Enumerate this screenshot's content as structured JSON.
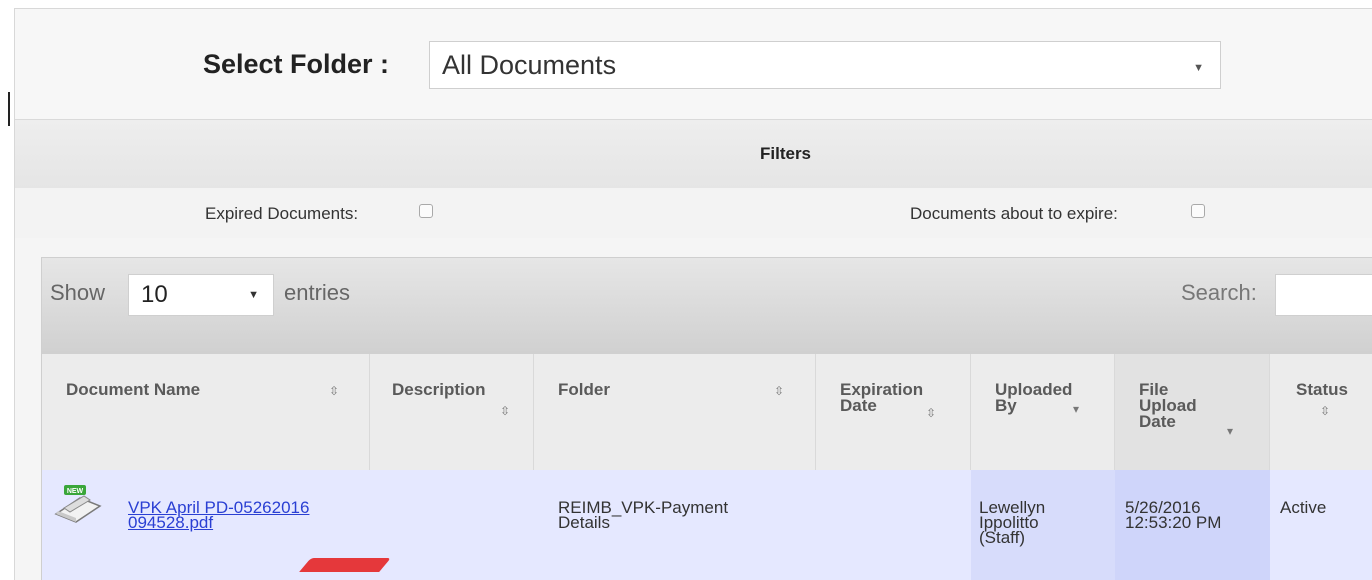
{
  "folder": {
    "label": "Select Folder :",
    "selected": "All Documents"
  },
  "filters": {
    "title": "Filters",
    "expired_label": "Expired Documents:",
    "about_to_expire_label": "Documents about to expire:"
  },
  "table_controls": {
    "show_label": "Show",
    "length_value": "10",
    "entries_label": "entries",
    "search_label": "Search:"
  },
  "columns": [
    {
      "line1": "Document Name",
      "line2": "",
      "line3": ""
    },
    {
      "line1": "Description",
      "line2": "",
      "line3": ""
    },
    {
      "line1": "Folder",
      "line2": "",
      "line3": ""
    },
    {
      "line1": "Expiration",
      "line2": "Date",
      "line3": ""
    },
    {
      "line1": "Uploaded",
      "line2": "By",
      "line3": ""
    },
    {
      "line1": "File",
      "line2": "Upload",
      "line3": "Date"
    },
    {
      "line1": "Status",
      "line2": "",
      "line3": ""
    }
  ],
  "rows": [
    {
      "badge": "NEW",
      "doc_name_line1": "VPK April PD-05262016",
      "doc_name_line2": "094528.pdf",
      "description": "",
      "folder_line1": "REIMB_VPK-Payment",
      "folder_line2": "Details",
      "expiration": "",
      "uploaded_line1": "Lewellyn",
      "uploaded_line2": "Ippolitto",
      "uploaded_line3": "(Staff)",
      "upload_date_line1": "5/26/2016",
      "upload_date_line2": "12:53:20 PM",
      "status": "Active"
    }
  ],
  "colors": {
    "link": "#2a3fd3",
    "row_bg": "#e5e8ff",
    "sorted_col_bg": "#d7dcfb",
    "badge": "#3aa63a"
  }
}
